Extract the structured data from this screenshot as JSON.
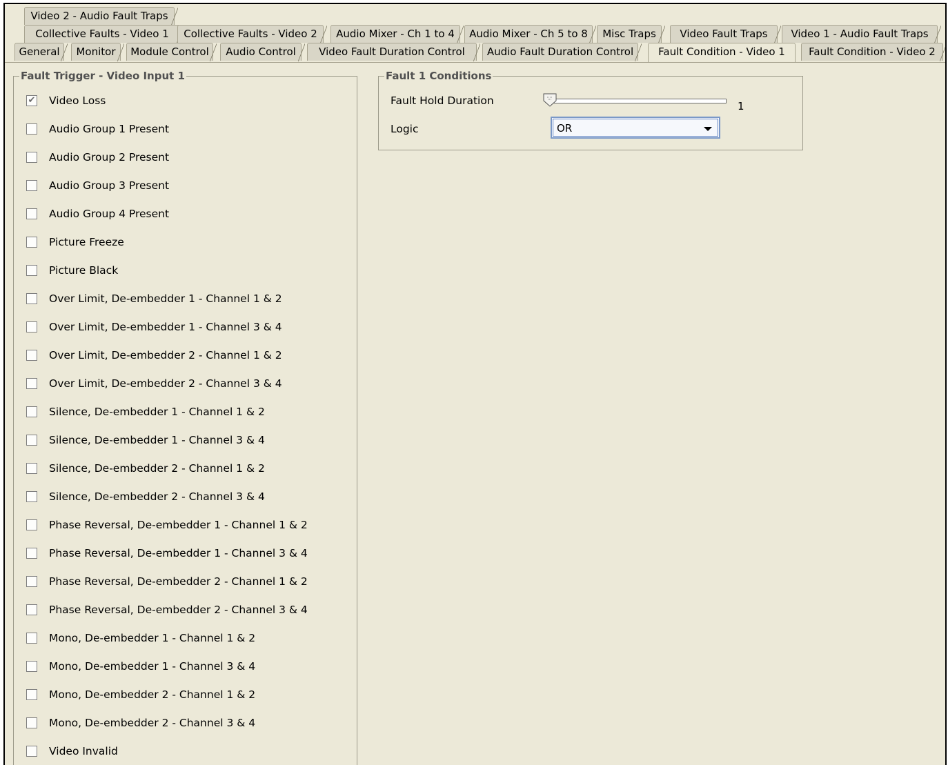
{
  "tab_rows": [
    [
      "Video 2 - Audio Fault Traps"
    ],
    [
      "Collective Faults - Video 1",
      "Collective Faults - Video 2",
      "Audio Mixer - Ch 1 to 4",
      "Audio Mixer - Ch 5 to 8",
      "Misc Traps",
      "Video Fault Traps",
      "Video 1 - Audio Fault Traps"
    ],
    [
      "General",
      "Monitor",
      "Module Control",
      "Audio Control",
      "Video Fault Duration Control",
      "Audio Fault Duration Control",
      "Fault Condition - Video 1",
      "Fault Condition - Video 2"
    ]
  ],
  "selected_tab": "Fault Condition - Video 1",
  "fault_trigger": {
    "title": "Fault Trigger - Video Input 1",
    "items": [
      {
        "label": "Video Loss",
        "checked": true
      },
      {
        "label": "Audio Group 1 Present",
        "checked": false
      },
      {
        "label": "Audio Group 2 Present",
        "checked": false
      },
      {
        "label": "Audio Group 3 Present",
        "checked": false
      },
      {
        "label": "Audio Group 4 Present",
        "checked": false
      },
      {
        "label": "Picture Freeze",
        "checked": false
      },
      {
        "label": "Picture Black",
        "checked": false
      },
      {
        "label": "Over Limit, De-embedder 1 - Channel 1 & 2",
        "checked": false
      },
      {
        "label": "Over Limit, De-embedder 1 - Channel 3 & 4",
        "checked": false
      },
      {
        "label": "Over Limit, De-embedder 2 - Channel 1 & 2",
        "checked": false
      },
      {
        "label": "Over Limit, De-embedder 2 - Channel 3 & 4",
        "checked": false
      },
      {
        "label": "Silence, De-embedder 1 - Channel 1 & 2",
        "checked": false
      },
      {
        "label": "Silence, De-embedder 1 - Channel 3 & 4",
        "checked": false
      },
      {
        "label": "Silence, De-embedder 2 - Channel 1 & 2",
        "checked": false
      },
      {
        "label": "Silence, De-embedder 2 - Channel 3 & 4",
        "checked": false
      },
      {
        "label": "Phase Reversal, De-embedder 1 - Channel 1 & 2",
        "checked": false
      },
      {
        "label": "Phase Reversal, De-embedder 1 - Channel 3 & 4",
        "checked": false
      },
      {
        "label": "Phase Reversal, De-embedder 2 - Channel 1 & 2",
        "checked": false
      },
      {
        "label": "Phase Reversal, De-embedder 2 - Channel 3 & 4",
        "checked": false
      },
      {
        "label": "Mono, De-embedder 1 - Channel 1 & 2",
        "checked": false
      },
      {
        "label": "Mono, De-embedder 1 - Channel 3 & 4",
        "checked": false
      },
      {
        "label": "Mono, De-embedder 2 - Channel 1 & 2",
        "checked": false
      },
      {
        "label": "Mono, De-embedder 2 - Channel 3 & 4",
        "checked": false
      },
      {
        "label": "Video Invalid",
        "checked": false
      }
    ]
  },
  "fault_conditions": {
    "title": "Fault 1 Conditions",
    "hold_duration_label": "Fault Hold Duration",
    "hold_duration_value": "1",
    "hold_duration_fraction": 0.0,
    "logic_label": "Logic",
    "logic_value": "OR"
  },
  "colors": {
    "background": "#ece9d8",
    "tab_background": "#d9d6c7",
    "focus_border": "#7a98c8"
  }
}
